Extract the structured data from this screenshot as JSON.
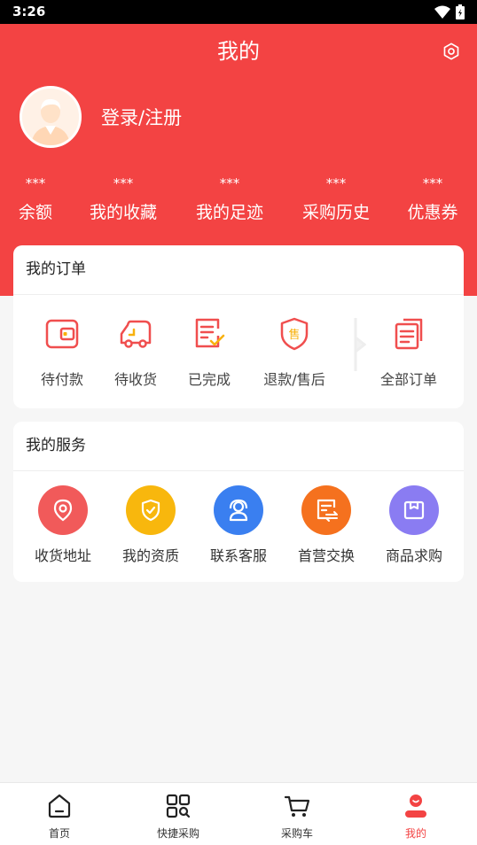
{
  "status_bar": {
    "time": "3:26"
  },
  "header": {
    "title": "我的",
    "login_text": "登录/注册"
  },
  "stats": [
    {
      "value": "***",
      "label": "余额"
    },
    {
      "value": "***",
      "label": "我的收藏"
    },
    {
      "value": "***",
      "label": "我的足迹"
    },
    {
      "value": "***",
      "label": "采购历史"
    },
    {
      "value": "***",
      "label": "优惠券"
    }
  ],
  "orders": {
    "title": "我的订单",
    "items": [
      {
        "label": "待付款",
        "icon": "wallet-icon"
      },
      {
        "label": "待收货",
        "icon": "truck-icon"
      },
      {
        "label": "已完成",
        "icon": "checklist-icon"
      },
      {
        "label": "退款/售后",
        "icon": "after-sale-shield-icon"
      },
      {
        "label": "全部订单",
        "icon": "all-orders-icon"
      }
    ]
  },
  "services": {
    "title": "我的服务",
    "items": [
      {
        "label": "收货地址",
        "icon": "location-pin-icon",
        "color": "#f15a5a"
      },
      {
        "label": "我的资质",
        "icon": "shield-check-icon",
        "color": "#f8b70d"
      },
      {
        "label": "联系客服",
        "icon": "customer-service-icon",
        "color": "#3a7ff0"
      },
      {
        "label": "首营交换",
        "icon": "exchange-document-icon",
        "color": "#f5711e"
      },
      {
        "label": "商品求购",
        "icon": "box-icon",
        "color": "#8a7cf2"
      }
    ]
  },
  "bottom_nav": [
    {
      "label": "首页",
      "icon": "home-icon"
    },
    {
      "label": "快捷采购",
      "icon": "scan-grid-icon"
    },
    {
      "label": "采购车",
      "icon": "cart-icon"
    },
    {
      "label": "我的",
      "icon": "user-icon",
      "active": true
    }
  ],
  "colors": {
    "brand_red": "#f34343",
    "background": "#f6f6f6"
  }
}
